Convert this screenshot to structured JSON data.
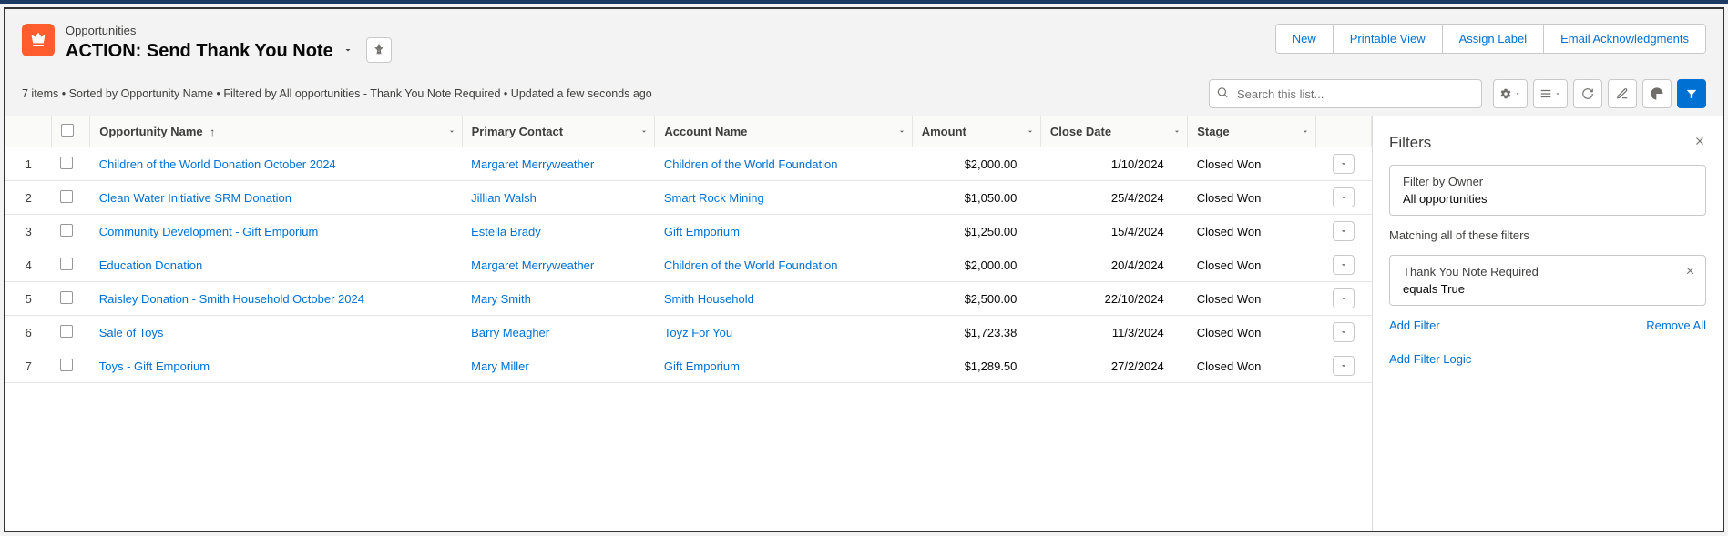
{
  "header": {
    "object_label": "Opportunities",
    "view_title": "ACTION: Send Thank You Note",
    "meta": "7 items • Sorted by Opportunity Name • Filtered by All opportunities - Thank You Note Required • Updated a few seconds ago",
    "actions": {
      "new": "New",
      "printable": "Printable View",
      "assign_label": "Assign Label",
      "email_ack": "Email Acknowledgments"
    },
    "search_placeholder": "Search this list..."
  },
  "columns": {
    "opportunity_name": "Opportunity Name",
    "primary_contact": "Primary Contact",
    "account_name": "Account Name",
    "amount": "Amount",
    "close_date": "Close Date",
    "stage": "Stage"
  },
  "rows": [
    {
      "num": "1",
      "opp": "Children of the World Donation October 2024",
      "pc": "Margaret Merryweather",
      "acc": "Children of the World Foundation",
      "amt": "$2,000.00",
      "cd": "1/10/2024",
      "stg": "Closed Won"
    },
    {
      "num": "2",
      "opp": "Clean Water Initiative SRM Donation",
      "pc": "Jillian Walsh",
      "acc": "Smart Rock Mining",
      "amt": "$1,050.00",
      "cd": "25/4/2024",
      "stg": "Closed Won"
    },
    {
      "num": "3",
      "opp": "Community Development - Gift Emporium",
      "pc": "Estella Brady",
      "acc": "Gift Emporium",
      "amt": "$1,250.00",
      "cd": "15/4/2024",
      "stg": "Closed Won"
    },
    {
      "num": "4",
      "opp": "Education Donation",
      "pc": "Margaret Merryweather",
      "acc": "Children of the World Foundation",
      "amt": "$2,000.00",
      "cd": "20/4/2024",
      "stg": "Closed Won"
    },
    {
      "num": "5",
      "opp": "Raisley Donation - Smith Household October 2024",
      "pc": "Mary Smith",
      "acc": "Smith Household",
      "amt": "$2,500.00",
      "cd": "22/10/2024",
      "stg": "Closed Won"
    },
    {
      "num": "6",
      "opp": "Sale of Toys",
      "pc": "Barry Meagher",
      "acc": "Toyz For You",
      "amt": "$1,723.38",
      "cd": "11/3/2024",
      "stg": "Closed Won"
    },
    {
      "num": "7",
      "opp": "Toys - Gift Emporium",
      "pc": "Mary Miller",
      "acc": "Gift Emporium",
      "amt": "$1,289.50",
      "cd": "27/2/2024",
      "stg": "Closed Won"
    }
  ],
  "filters": {
    "title": "Filters",
    "owner_label": "Filter by Owner",
    "owner_value": "All opportunities",
    "matching_label": "Matching all of these filters",
    "rule_field": "Thank You Note Required",
    "rule_op_val": "equals  True",
    "add_filter": "Add Filter",
    "remove_all": "Remove All",
    "add_logic": "Add Filter Logic"
  }
}
